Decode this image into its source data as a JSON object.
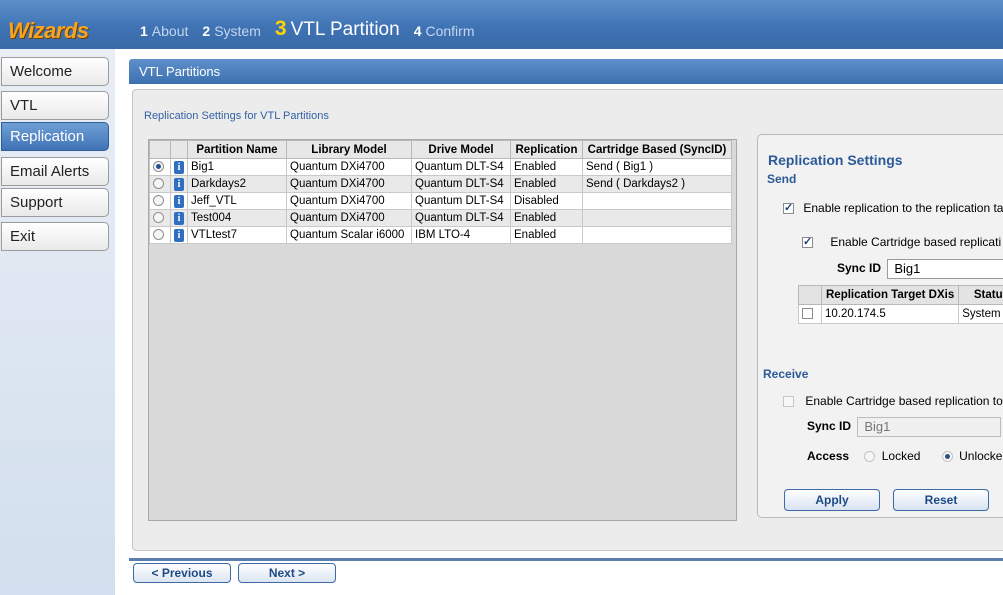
{
  "wizard": {
    "brand": "Wizards",
    "steps": [
      {
        "num": "1",
        "label": "About"
      },
      {
        "num": "2",
        "label": "System"
      },
      {
        "num": "3",
        "label": "VTL Partition"
      },
      {
        "num": "4",
        "label": "Confirm"
      }
    ]
  },
  "sidebar": {
    "items": [
      {
        "label": "Welcome"
      },
      {
        "label": "VTL"
      },
      {
        "label": "Replication"
      },
      {
        "label": "Email Alerts"
      },
      {
        "label": "Support"
      },
      {
        "label": "Exit"
      }
    ],
    "active": "Replication"
  },
  "main": {
    "header": "VTL Partitions",
    "panel_title": "Replication Settings for VTL Partitions",
    "table": {
      "columns": [
        "Partition Name",
        "Library Model",
        "Drive Model",
        "Replication",
        "Cartridge Based (SyncID)"
      ],
      "rows": [
        {
          "name": "Big1",
          "library": "Quantum DXi4700",
          "drive": "Quantum DLT-S4",
          "replication": "Enabled",
          "cartridge": "Send ( Big1 )"
        },
        {
          "name": "Darkdays2",
          "library": "Quantum DXi4700",
          "drive": "Quantum DLT-S4",
          "replication": "Enabled",
          "cartridge": "Send ( Darkdays2 )"
        },
        {
          "name": "Jeff_VTL",
          "library": "Quantum DXi4700",
          "drive": "Quantum DLT-S4",
          "replication": "Disabled",
          "cartridge": ""
        },
        {
          "name": "Test004",
          "library": "Quantum DXi4700",
          "drive": "Quantum DLT-S4",
          "replication": "Enabled",
          "cartridge": ""
        },
        {
          "name": "VTLtest7",
          "library": "Quantum Scalar i6000",
          "drive": "IBM LTO-4",
          "replication": "Enabled",
          "cartridge": ""
        }
      ]
    }
  },
  "settings": {
    "title": "Replication Settings",
    "send": {
      "label": "Send",
      "enable_label": "Enable replication to the replication targ",
      "cartridge_label": "Enable Cartridge based replicati",
      "sync_label": "Sync ID",
      "sync_value": "Big1",
      "target_columns": [
        "Replication Target DXis",
        "Statu"
      ],
      "targets": [
        {
          "ip": "10.20.174.5",
          "status": "System P"
        }
      ]
    },
    "receive": {
      "label": "Receive",
      "cartridge_label": "Enable Cartridge based replication to",
      "sync_label": "Sync ID",
      "sync_value": "Big1",
      "help": "?",
      "access_label": "Access",
      "locked_label": "Locked",
      "unlocked_label": "Unlocked"
    },
    "apply_label": "Apply",
    "reset_label": "Reset"
  },
  "footer": {
    "previous_label": "< Previous",
    "next_label": "Next >"
  }
}
